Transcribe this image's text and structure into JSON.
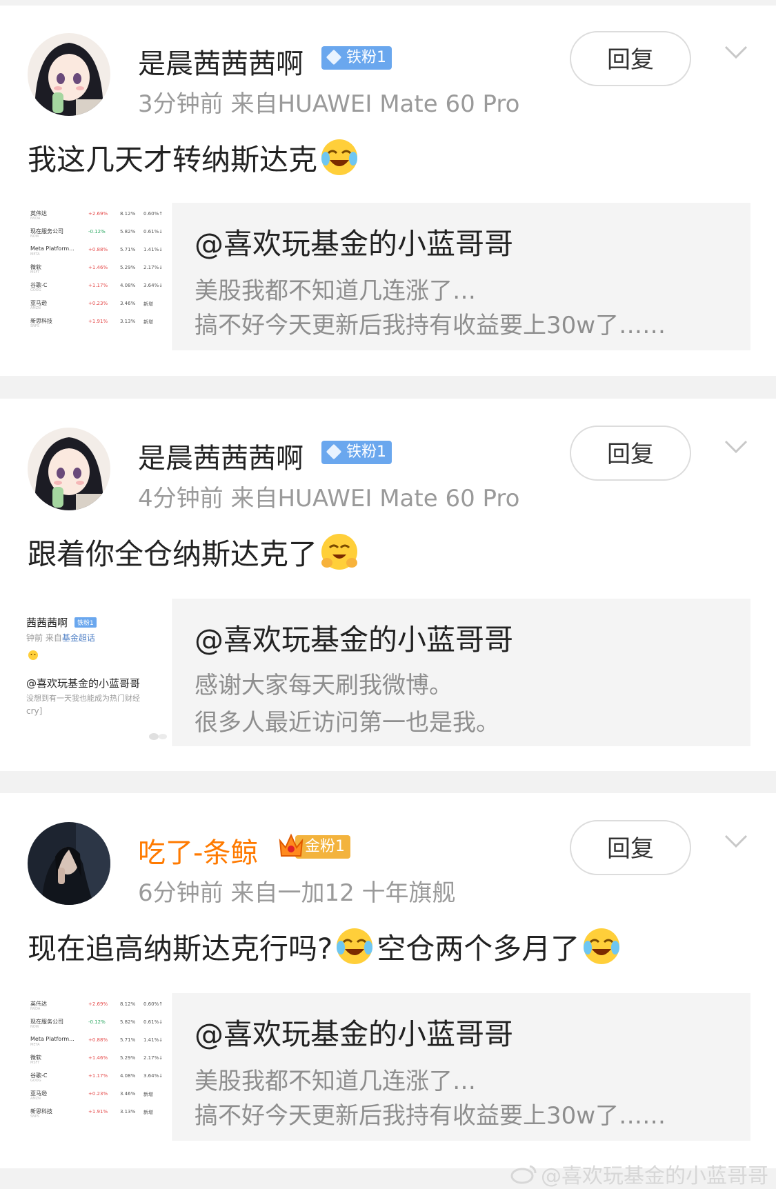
{
  "reply_label": "回复",
  "watermark": "@喜欢玩基金的小蓝哥哥",
  "comments": [
    {
      "username": "是晨茜茜茜啊",
      "badge": "铁粉1",
      "time_source": "3分钟前  来自HUAWEI Mate 60 Pro",
      "text": "我这几天才转纳斯达克",
      "quote": {
        "user": "@喜欢玩基金的小蓝哥哥",
        "line1": "美股我都不知道几连涨了…",
        "line2": "搞不好今天更新后我持有收益要上30w了……"
      }
    },
    {
      "username": "是晨茜茜茜啊",
      "badge": "铁粉1",
      "time_source": "4分钟前  来自HUAWEI Mate 60 Pro",
      "text": "跟着你全仓纳斯达克了",
      "quote": {
        "user": "@喜欢玩基金的小蓝哥哥",
        "line1": "感谢大家每天刷我微博。",
        "line2": "很多人最近访问第一也是我。"
      },
      "thumb": {
        "name": "茜茜茜啊",
        "badge": "铁粉1",
        "meta": "钟前  来自",
        "source": "基金超话",
        "mention": "@喜欢玩基金的小蓝哥哥",
        "body": "没想到有一天我也能成为热门财经",
        "tail": "cry]"
      }
    },
    {
      "username": "吃了-条鲸",
      "badge": "金粉1",
      "time_source": "6分钟前  来自一加12 十年旗舰",
      "text_a": "现在追高纳斯达克行吗?",
      "text_b": "空仓两个多月了",
      "quote": {
        "user": "@喜欢玩基金的小蓝哥哥",
        "line1": "美股我都不知道几连涨了…",
        "line2": "搞不好今天更新后我持有收益要上30w了……"
      }
    }
  ],
  "stock_thumb": {
    "rows": [
      {
        "name": "英伟达",
        "ticker": "NVDA",
        "change": "+2.69%",
        "weight": "8.12%",
        "ratio": "0.60%↑",
        "dir": "up"
      },
      {
        "name": "现在服务公司",
        "ticker": "NOW",
        "change": "-0.12%",
        "weight": "5.82%",
        "ratio": "0.61%↓",
        "dir": "down"
      },
      {
        "name": "Meta Platform...",
        "ticker": "META",
        "change": "+0.88%",
        "weight": "5.71%",
        "ratio": "1.41%↓",
        "dir": "up"
      },
      {
        "name": "微软",
        "ticker": "MSFT",
        "change": "+1.46%",
        "weight": "5.29%",
        "ratio": "2.17%↓",
        "dir": "up"
      },
      {
        "name": "谷歌-C",
        "ticker": "GOOG",
        "change": "+1.17%",
        "weight": "4.08%",
        "ratio": "3.64%↓",
        "dir": "up"
      },
      {
        "name": "亚马逊",
        "ticker": "AMZN",
        "change": "+0.23%",
        "weight": "3.46%",
        "ratio": "新增",
        "dir": "up"
      },
      {
        "name": "新思科技",
        "ticker": "SNPS",
        "change": "+1.91%",
        "weight": "3.13%",
        "ratio": "新增",
        "dir": "up"
      }
    ]
  },
  "colors": {
    "background": "#f2f2f2",
    "card": "#ffffff",
    "quote_bg": "#f4f4f4",
    "badge_blue": "#6aa7ee",
    "badge_gold": "#f3b33d",
    "orange_name": "#ff7a00"
  },
  "icons": [
    "diamond-badge-icon",
    "crown-icon",
    "chevron-down-icon",
    "laughing-crying-emoji",
    "smiling-hands-emoji",
    "weibo-logo-icon"
  ]
}
